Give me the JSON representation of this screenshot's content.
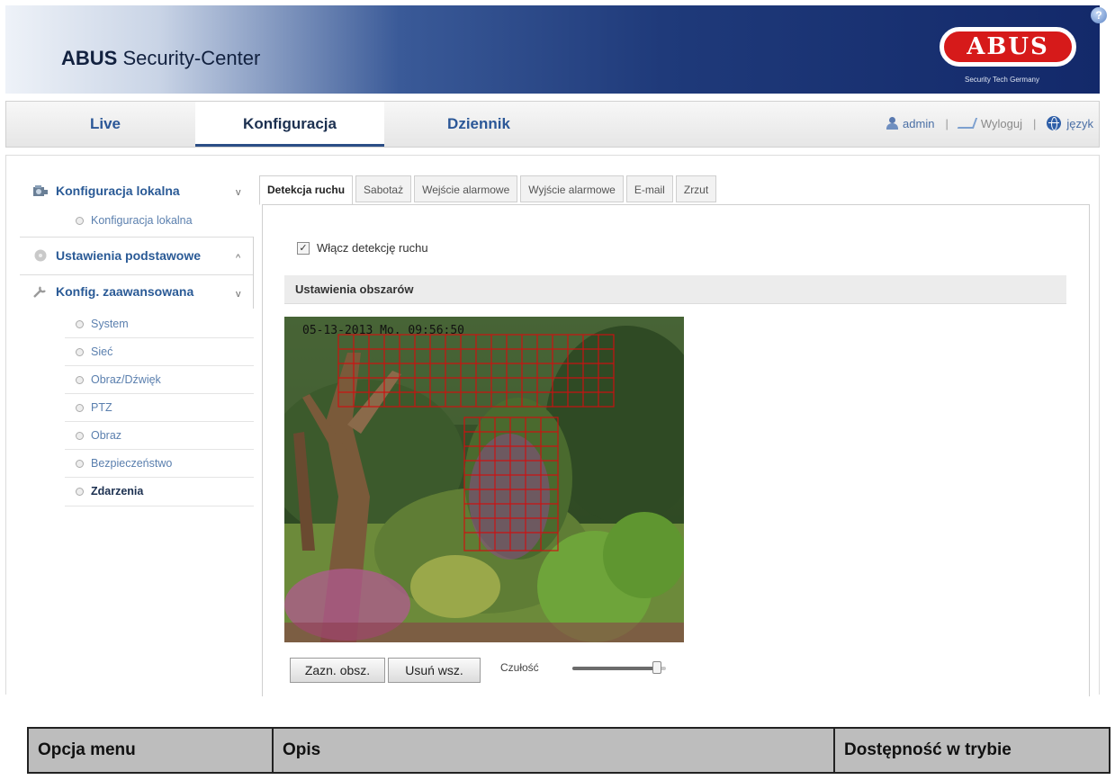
{
  "header": {
    "app_bold": "ABUS",
    "app_rest": " Security-Center",
    "logo_text": "ABUS",
    "logo_tagline": "Security Tech Germany",
    "help_glyph": "?"
  },
  "nav": {
    "tabs": [
      {
        "label": "Live"
      },
      {
        "label": "Konfiguracja"
      },
      {
        "label": "Dziennik"
      }
    ],
    "user": "admin",
    "logout": "Wyloguj",
    "language": "język"
  },
  "sidebar": {
    "groups": [
      {
        "label": "Konfiguracja lokalna",
        "chevron": "v",
        "icon": "camera-icon"
      },
      {
        "label": "Ustawienia podstawowe",
        "chevron": "^",
        "icon": "disc-icon"
      },
      {
        "label": "Konfig. zaawansowana",
        "chevron": "v",
        "icon": "wrench-icon"
      }
    ],
    "local_items": [
      "Konfiguracja lokalna"
    ],
    "advanced_items": [
      "System",
      "Sieć",
      "Obraz/Dźwięk",
      "PTZ",
      "Obraz",
      "Bezpieczeństwo",
      "Zdarzenia"
    ]
  },
  "tabs": [
    "Detekcja ruchu",
    "Sabotaż",
    "Wejście alarmowe",
    "Wyjście alarmowe",
    "E-mail",
    "Zrzut"
  ],
  "motion": {
    "enable_label": "Włącz detekcję ruchu",
    "enabled": true,
    "checkmark": "✓",
    "area_settings": "Ustawienia obszarów",
    "osd_time": "05-13-2013 Mo. 09:56:50",
    "draw_button": "Zazn. obsz.",
    "clear_button": "Usuń wsz.",
    "sensitivity_label": "Czułość",
    "sensitivity_level": 0.95
  },
  "table": {
    "headers": [
      "Opcja menu",
      "Opis",
      "Dostępność w trybie"
    ]
  },
  "colors": {
    "grid_red": "#d01010",
    "link_blue": "#2a5a96"
  }
}
